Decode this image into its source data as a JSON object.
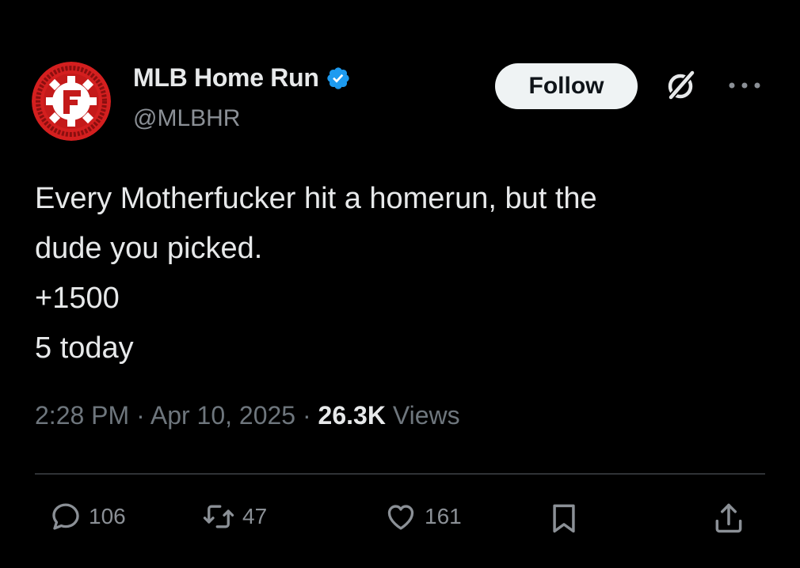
{
  "account": {
    "display_name": "MLB Home Run",
    "handle": "@MLBHR",
    "verified": true,
    "avatar_icon": "red-gear-logo-icon",
    "verified_color": "#1d9bf0"
  },
  "header": {
    "follow_label": "Follow",
    "grok_icon": "grok-icon",
    "more_icon": "more-options-icon"
  },
  "tweet": {
    "lines": [
      "Every Motherfucker hit a homerun, but the",
      "dude you picked.",
      "+1500",
      "5 today"
    ]
  },
  "meta": {
    "time": "2:28 PM",
    "separator": "·",
    "date": "Apr 10, 2025",
    "views_count": "26.3K",
    "views_label": "Views"
  },
  "actions": {
    "replies": "106",
    "reposts": "47",
    "likes": "161",
    "bookmark_icon": "bookmark-icon",
    "share_icon": "share-icon"
  }
}
